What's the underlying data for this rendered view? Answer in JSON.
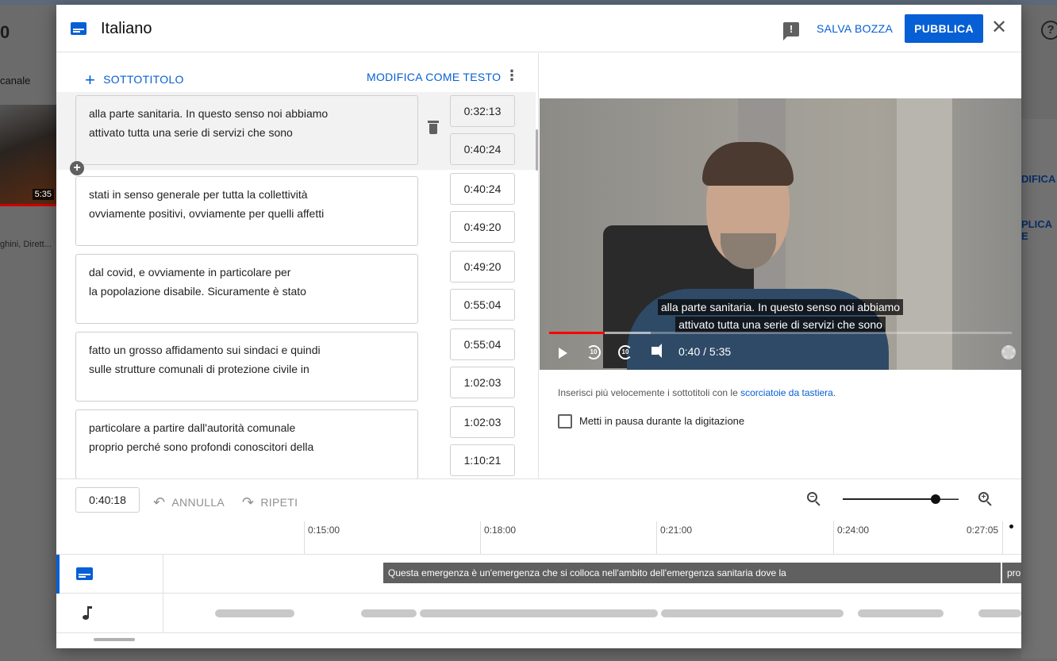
{
  "background": {
    "count_partial": "0",
    "channel_label": "canale",
    "video_duration": "5:35",
    "names_snippet": "ghini, Dirett...",
    "right_link_1": "DIFICA",
    "right_link_2": "PLICA E"
  },
  "dialog": {
    "title": "Italiano",
    "save_draft_label": "SALVA BOZZA",
    "publish_label": "PUBBLICA",
    "feedback_icon": "feedback-icon",
    "close_icon": "close-icon"
  },
  "editor": {
    "add_subtitle_label": "SOTTOTITOLO",
    "edit_as_text_label": "MODIFICA COME TESTO",
    "cues": [
      {
        "line1": "alla parte sanitaria. In questo senso noi abbiamo",
        "line2": "attivato tutta una serie di servizi che sono",
        "start": "0:32:13",
        "end": "0:40:24",
        "active": true
      },
      {
        "line1": "stati in senso generale per tutta la collettività",
        "line2": "ovviamente positivi, ovviamente per quelli affetti",
        "start": "0:40:24",
        "end": "0:49:20"
      },
      {
        "line1": "dal covid, e ovviamente in particolare per",
        "line2": "la popolazione disabile. Sicuramente è stato",
        "start": "0:49:20",
        "end": "0:55:04"
      },
      {
        "line1": "fatto un grosso affidamento sui sindaci e quindi",
        "line2": "sulle strutture comunali di protezione civile in",
        "start": "0:55:04",
        "end": "1:02:03"
      },
      {
        "line1": "particolare a partire dall'autorità comunale",
        "line2": "proprio perché sono profondi conoscitori della",
        "start": "1:02:03",
        "end": "1:10:21"
      }
    ]
  },
  "player": {
    "caption_line1": "alla parte sanitaria. In questo senso noi abbiamo",
    "caption_line2": "attivato tutta una serie di servizi che sono",
    "time_display": "0:40 / 5:35",
    "played_fraction": 0.12,
    "buffered_fraction": 0.22,
    "rewind_label": "10",
    "forward_label": "10"
  },
  "options": {
    "hint_text": "Inserisci più velocemente i sottotitoli con le ",
    "hint_link": "scorciatoie da tastiera",
    "hint_end": ".",
    "pause_label": "Metti in pausa durante la digitazione",
    "pause_checked": false
  },
  "timeline": {
    "current_time": "0:40:18",
    "undo_label": "ANNULLA",
    "redo_label": "RIPETI",
    "zoom_level": 0.8,
    "ruler_labels": [
      "0:15:00",
      "0:18:00",
      "0:21:00",
      "0:24:00",
      "0:27:05"
    ],
    "subtitle_blocks": [
      {
        "text": "Questa emergenza è un'emergenza che si colloca  nell'ambito dell'emergenza sanitaria dove la"
      },
      {
        "text": "pro"
      }
    ]
  },
  "colors": {
    "accent": "#065fd4",
    "progress_red": "#ff0000"
  }
}
